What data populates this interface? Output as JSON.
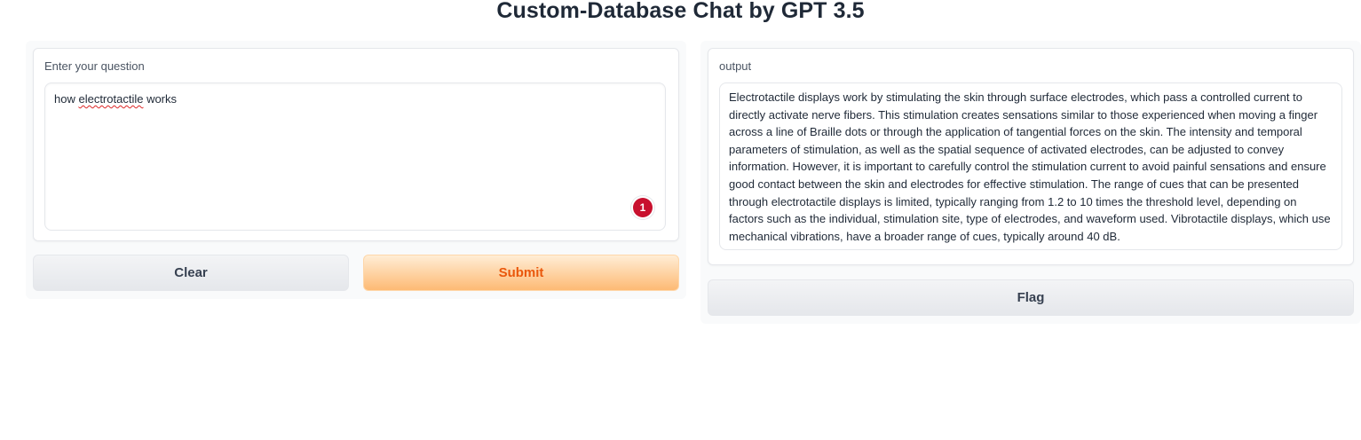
{
  "header": {
    "title": "Custom-Database Chat by GPT 3.5"
  },
  "input_panel": {
    "label": "Enter your question",
    "question_prefix": "how ",
    "question_misspelled": "electrotactile",
    "question_suffix": " works",
    "badge_count": "1",
    "clear_label": "Clear",
    "submit_label": "Submit"
  },
  "output_panel": {
    "label": "output",
    "text": "Electrotactile displays work by stimulating the skin through surface electrodes, which pass a controlled current to directly activate nerve fibers. This stimulation creates sensations similar to those experienced when moving a finger across a line of Braille dots or through the application of tangential forces on the skin. The intensity and temporal parameters of stimulation, as well as the spatial sequence of activated electrodes, can be adjusted to convey information. However, it is important to carefully control the stimulation current to avoid painful sensations and ensure good contact between the skin and electrodes for effective stimulation. The range of cues that can be presented through electrotactile displays is limited, typically ranging from 1.2 to 10 times the threshold level, depending on factors such as the individual, stimulation site, type of electrodes, and waveform used. Vibrotactile displays, which use mechanical vibrations, have a broader range of cues, typically around 40 dB.",
    "flag_label": "Flag"
  },
  "colors": {
    "submit_text": "#ea580c",
    "badge": "#c8102e"
  }
}
